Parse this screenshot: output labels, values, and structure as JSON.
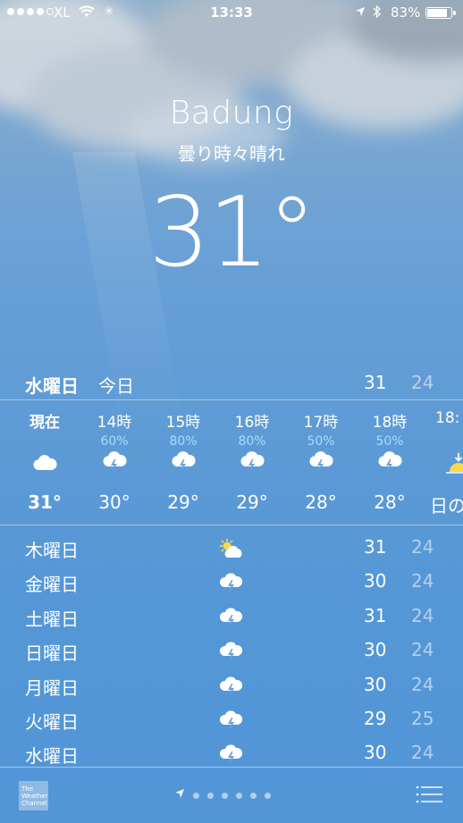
{
  "status_bar": {
    "carrier": "XL",
    "time": "13:33",
    "battery_text": "83%",
    "battery_level": 0.83,
    "signal_bars": 4
  },
  "header": {
    "city": "Badung",
    "condition": "曇り時々晴れ",
    "temperature": "31°"
  },
  "today": {
    "day": "水曜日",
    "label": "今日",
    "high": "31",
    "low": "24"
  },
  "hourly": [
    {
      "time": "現在",
      "pop": "",
      "icon": "cloud-icon",
      "temp": "31°"
    },
    {
      "time": "14時",
      "pop": "60%",
      "icon": "thunderstorm-icon",
      "temp": "30°"
    },
    {
      "time": "15時",
      "pop": "80%",
      "icon": "thunderstorm-icon",
      "temp": "29°"
    },
    {
      "time": "16時",
      "pop": "80%",
      "icon": "thunderstorm-icon",
      "temp": "29°"
    },
    {
      "time": "17時",
      "pop": "50%",
      "icon": "thunderstorm-icon",
      "temp": "28°"
    },
    {
      "time": "18時",
      "pop": "50%",
      "icon": "thunderstorm-icon",
      "temp": "28°"
    },
    {
      "time": "18:",
      "pop": "",
      "icon": "sunset-icon",
      "temp": "日の"
    }
  ],
  "daily": [
    {
      "day": "木曜日",
      "icon": "partly-sunny-icon",
      "high": "31",
      "low": "24"
    },
    {
      "day": "金曜日",
      "icon": "thunderstorm-icon",
      "high": "30",
      "low": "24"
    },
    {
      "day": "土曜日",
      "icon": "thunderstorm-icon",
      "high": "31",
      "low": "24"
    },
    {
      "day": "日曜日",
      "icon": "thunderstorm-icon",
      "high": "30",
      "low": "24"
    },
    {
      "day": "月曜日",
      "icon": "thunderstorm-icon",
      "high": "30",
      "low": "24"
    },
    {
      "day": "火曜日",
      "icon": "thunderstorm-icon",
      "high": "29",
      "low": "25"
    },
    {
      "day": "水曜日",
      "icon": "thunderstorm-icon",
      "high": "30",
      "low": "24"
    }
  ],
  "footer": {
    "logo_text": "The Weather Channel",
    "page_count": 6
  },
  "colors": {
    "pop_text": "#a9dcff",
    "sun": "#ffd84a"
  }
}
